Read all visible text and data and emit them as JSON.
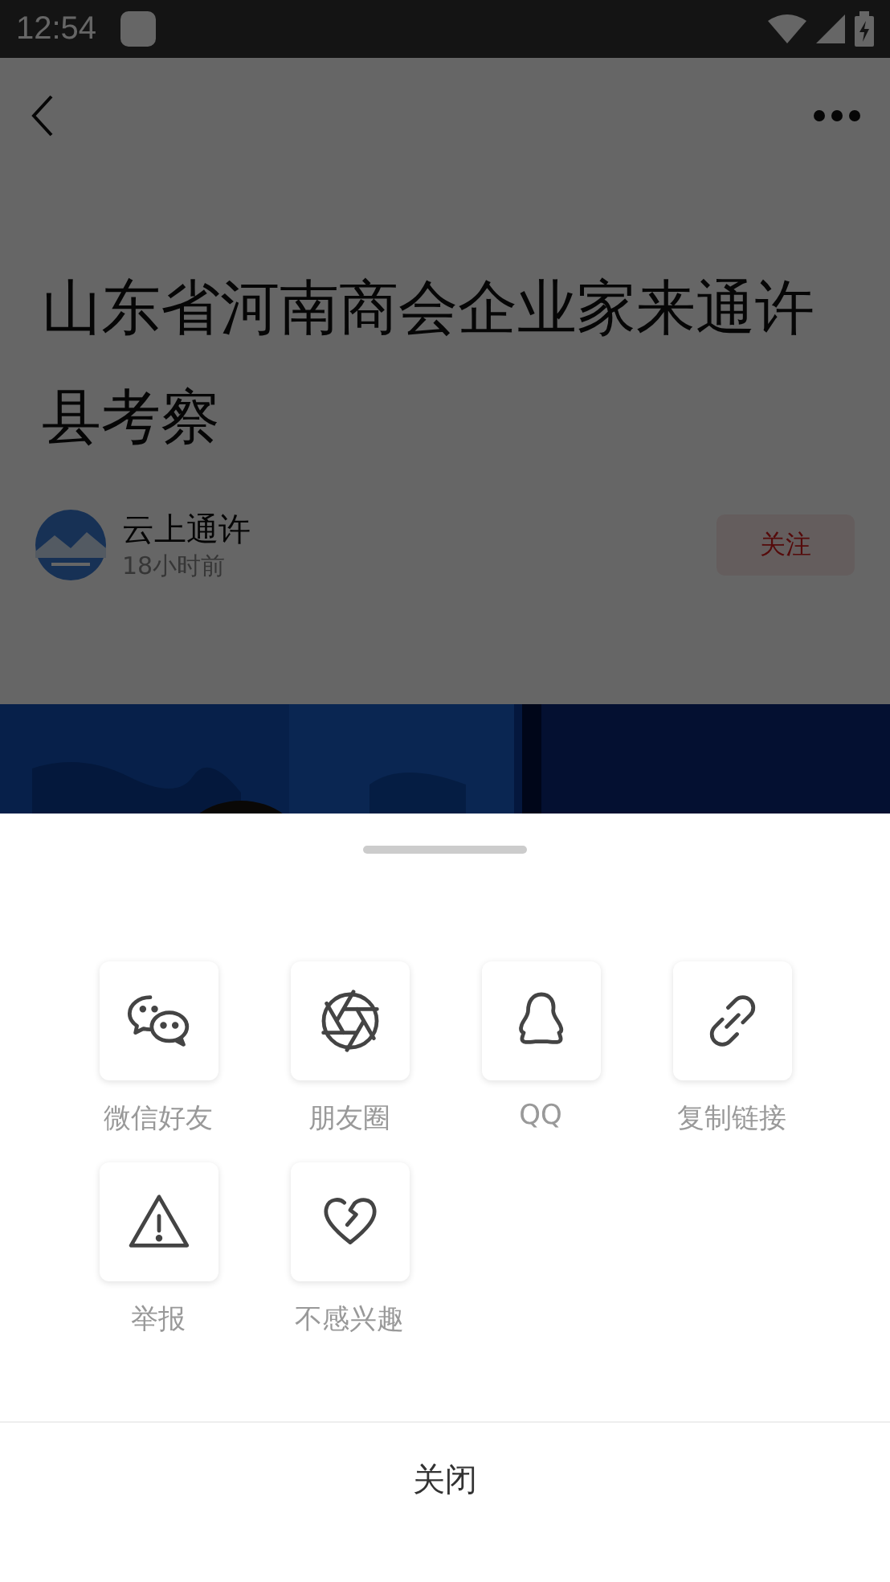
{
  "status_bar": {
    "time": "12:54"
  },
  "article": {
    "title": "山东省河南商会企业家来通许县考察",
    "author": "云上通许",
    "time": "18小时前",
    "follow_button": "关注"
  },
  "share_sheet": {
    "items": [
      {
        "label": "微信好友"
      },
      {
        "label": "朋友圈"
      },
      {
        "label": "QQ"
      },
      {
        "label": "复制链接"
      },
      {
        "label": "举报"
      },
      {
        "label": "不感兴趣"
      }
    ],
    "close_button": "关闭"
  }
}
